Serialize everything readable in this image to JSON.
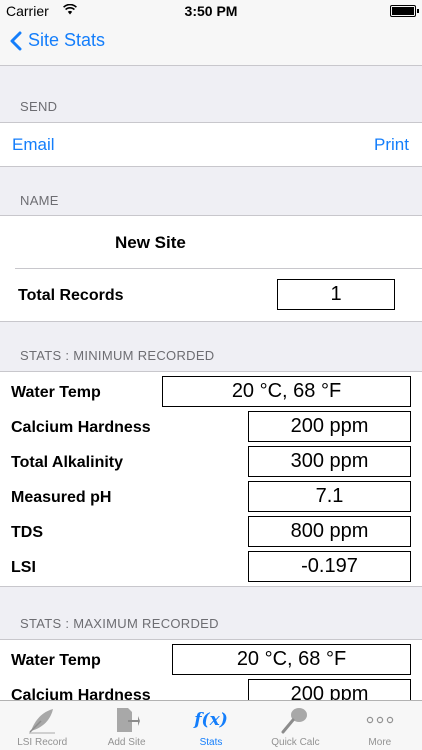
{
  "status_bar": {
    "carrier": "Carrier",
    "time": "3:50 PM",
    "battery_level": 1.0
  },
  "nav": {
    "back_label": "Site Stats"
  },
  "send": {
    "header": "SEND",
    "email_label": "Email",
    "print_label": "Print"
  },
  "name_section": {
    "header": "NAME",
    "site_name": "New Site",
    "total_records_label": "Total Records",
    "total_records_value": "1"
  },
  "stats_min": {
    "header": "STATS : MINIMUM RECORDED",
    "rows": [
      {
        "label": "Water Temp",
        "value": "20 °C, 68 °F"
      },
      {
        "label": "Calcium Hardness",
        "value": "200 ppm"
      },
      {
        "label": "Total Alkalinity",
        "value": "300 ppm"
      },
      {
        "label": "Measured pH",
        "value": "7.1"
      },
      {
        "label": "TDS",
        "value": "800 ppm"
      },
      {
        "label": "LSI",
        "value": "-0.197"
      }
    ]
  },
  "stats_max": {
    "header": "STATS : MAXIMUM RECORDED",
    "rows": [
      {
        "label": "Water Temp",
        "value": "20 °C, 68 °F"
      },
      {
        "label": "Calcium Hardness",
        "value": "200 ppm"
      }
    ]
  },
  "tabs": [
    {
      "label": "LSI Record",
      "icon": "feather-icon",
      "active": false
    },
    {
      "label": "Add Site",
      "icon": "add-site-icon",
      "active": false
    },
    {
      "label": "Stats",
      "icon": "function-icon",
      "active": true
    },
    {
      "label": "Quick Calc",
      "icon": "pool-net-icon",
      "active": false
    },
    {
      "label": "More",
      "icon": "more-icon",
      "active": false
    }
  ],
  "colors": {
    "accent": "#147efb",
    "background": "#efeff4",
    "inactive_tab": "#929292"
  }
}
